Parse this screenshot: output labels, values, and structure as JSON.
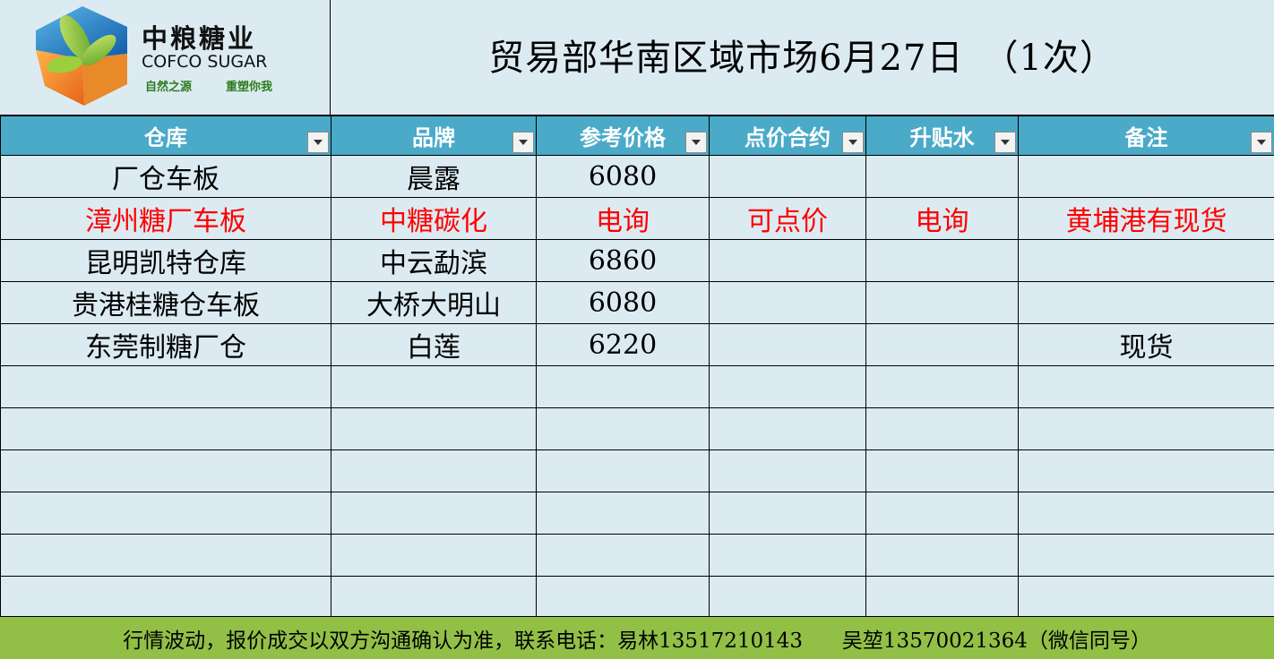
{
  "logo": {
    "name_cn": "中粮糖业",
    "name_en": "COFCO SUGAR",
    "slogan_left": "自然之源",
    "slogan_right": "重塑你我",
    "colors": {
      "blue": "#1a6fb8",
      "green": "#8cc63e",
      "orange": "#f28a1e",
      "slogan": "#2e7d1e"
    }
  },
  "title": "贸易部华南区域市场6月27日　（1次）",
  "columns": [
    "仓库",
    "品牌",
    "参考价格",
    "点价合约",
    "升贴水",
    "备注"
  ],
  "rows": [
    {
      "cells": [
        "厂仓车板",
        "晨露",
        "6080",
        "",
        "",
        ""
      ],
      "highlight": false
    },
    {
      "cells": [
        "漳州糖厂车板",
        "中糖碳化",
        "电询",
        "可点价",
        "电询",
        "黄埔港有现货"
      ],
      "highlight": true
    },
    {
      "cells": [
        "昆明凯特仓库",
        "中云勐滨",
        "6860",
        "",
        "",
        ""
      ],
      "highlight": false
    },
    {
      "cells": [
        "贵港桂糖仓车板",
        "大桥大明山",
        "6080",
        "",
        "",
        ""
      ],
      "highlight": false
    },
    {
      "cells": [
        "东莞制糖厂仓",
        "白莲",
        "6220",
        "",
        "",
        "现货"
      ],
      "highlight": false
    },
    {
      "cells": [
        "",
        "",
        "",
        "",
        "",
        ""
      ],
      "highlight": false
    },
    {
      "cells": [
        "",
        "",
        "",
        "",
        "",
        ""
      ],
      "highlight": false
    },
    {
      "cells": [
        "",
        "",
        "",
        "",
        "",
        ""
      ],
      "highlight": false
    },
    {
      "cells": [
        "",
        "",
        "",
        "",
        "",
        ""
      ],
      "highlight": false
    },
    {
      "cells": [
        "",
        "",
        "",
        "",
        "",
        ""
      ],
      "highlight": false
    },
    {
      "cells": [
        "",
        "",
        "",
        "",
        "",
        ""
      ],
      "highlight": false
    }
  ],
  "footer": "行情波动，报价成交以双方沟通确认为准，联系电话：易林13517210143      吴堃13570021364（微信同号）",
  "theme": {
    "background": "#dcebf2",
    "header_bg": "#4aaac8",
    "header_text": "#ffffff",
    "highlight_text": "#ff0000",
    "footer_bg": "#92c047"
  }
}
